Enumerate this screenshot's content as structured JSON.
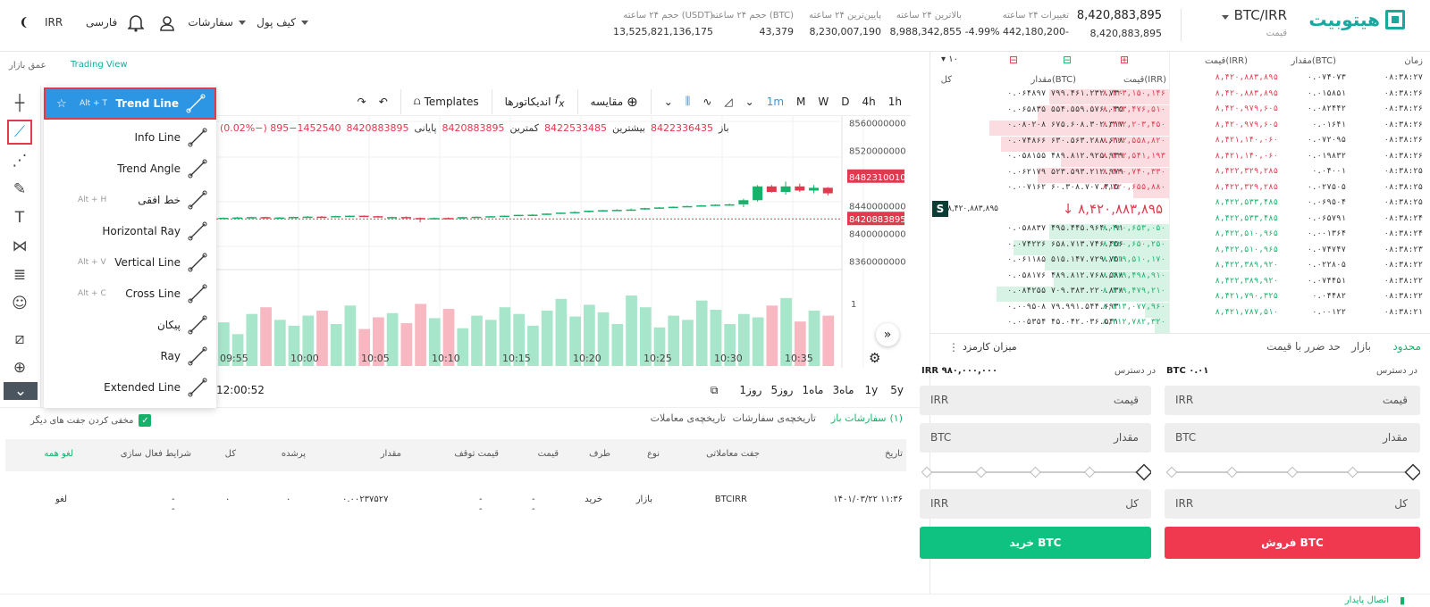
{
  "colors": {
    "accent": "#17b26a",
    "brand": "#18a8a0",
    "sell": "#e03a4e",
    "buy": "#0fc282",
    "highlight": "#2d96e4"
  },
  "header": {
    "logo": "هیتوبیت",
    "pair": "BTC/IRR",
    "pair_sub": "قیمت",
    "price_main": "8,420,883,895",
    "price_sub": "8,420,883,895",
    "stats": [
      {
        "label": "تغییرات ۲۴ ساعته",
        "value": "-4.99%  442,180,200-"
      },
      {
        "label": "بالاترین ۲۴ ساعته",
        "value": "8,988,342,855"
      },
      {
        "label": "پایین‌ترین ۲۴ ساعته",
        "value": "8,230,007,190"
      },
      {
        "label": "حجم ۲۴ ساعته (BTC)",
        "value": "43,379"
      },
      {
        "label": "حجم ۲۴ ساعته (USDT)",
        "value": "13,525,821,136,175"
      }
    ],
    "nav": {
      "wallet": "کیف پول",
      "orders": "سفارشات",
      "language": "فارسی",
      "currency": "IRR"
    }
  },
  "chart_tabs": {
    "trading_view": "Trading View",
    "depth": "عمق بازار"
  },
  "left_tools": [
    "crosshair-icon",
    "trend-line-icon",
    "fib-icon",
    "brush-icon",
    "text-icon",
    "pattern-icon",
    "prediction-icon",
    "emoji-icon",
    "ruler-icon",
    "zoom-in-icon",
    "collapse-icon"
  ],
  "draw_menu": [
    {
      "label": "Trend Line",
      "shortcut": "Alt + T",
      "icon": "trend-line-icon"
    },
    {
      "label": "Info Line",
      "shortcut": "",
      "icon": "info-line-icon"
    },
    {
      "label": "Trend Angle",
      "shortcut": "",
      "icon": "trend-angle-icon"
    },
    {
      "label": "خط افقی",
      "shortcut": "Alt + H",
      "icon": "horizontal-line-icon"
    },
    {
      "label": "Horizontal Ray",
      "shortcut": "",
      "icon": "horizontal-ray-icon"
    },
    {
      "label": "Vertical Line",
      "shortcut": "Alt + V",
      "icon": "vertical-line-icon"
    },
    {
      "label": "Cross Line",
      "shortcut": "Alt + C",
      "icon": "cross-line-icon"
    },
    {
      "label": "پیکان",
      "shortcut": "",
      "icon": "arrow-icon"
    },
    {
      "label": "Ray",
      "shortcut": "",
      "icon": "ray-icon"
    },
    {
      "label": "Extended Line",
      "shortcut": "",
      "icon": "extended-line-icon"
    }
  ],
  "chart_toolbar": {
    "intervals": [
      "1h",
      "4h",
      "D",
      "W",
      "M",
      "1m"
    ],
    "compare": "مقایسه",
    "indicators": "اندیکاتورها",
    "templates": "Templates"
  },
  "ohlc": {
    "open_label": "باز",
    "open": "8422336435",
    "high_label": "بیشترین",
    "high": "8422533485",
    "low_label": "کمترین",
    "low": "8420883895",
    "close_label": "پایانی",
    "close": "8420883895",
    "change": "895−1452540 (−0.02%)"
  },
  "price_axis": [
    "8560000000",
    "8520000000",
    "8482310010",
    "8440000000",
    "8420883895",
    "8400000000",
    "8360000000"
  ],
  "volume_axis": "1",
  "time_axis": [
    "09:55",
    "10:00",
    "10:05",
    "10:10",
    "10:15",
    "10:20",
    "10:25",
    "10:30",
    "10:35"
  ],
  "timeframe": {
    "ranges": [
      "5y",
      "1y",
      "3ماه",
      "1ماه",
      "5روز",
      "1روز"
    ],
    "clock": "12:00:52"
  },
  "chart_data": {
    "type": "candlestick",
    "candles": [
      [
        8422,
        8423,
        8421,
        8422.5
      ],
      [
        8422.5,
        8424,
        8422,
        8423
      ],
      [
        8423,
        8424,
        8422.5,
        8423.5
      ],
      [
        8423.5,
        8424,
        8422,
        8422.2
      ],
      [
        8422.2,
        8423.5,
        8421.5,
        8423
      ],
      [
        8423,
        8424,
        8422.5,
        8423.8
      ],
      [
        8423.8,
        8425,
        8423,
        8424.2
      ],
      [
        8424.2,
        8425,
        8423.5,
        8424
      ],
      [
        8424,
        8425.5,
        8423.5,
        8425
      ],
      [
        8425,
        8426,
        8424.5,
        8425.5
      ],
      [
        8425.5,
        8426,
        8424.5,
        8424.8
      ],
      [
        8424.8,
        8425.5,
        8423,
        8423.4
      ],
      [
        8423.4,
        8424,
        8422.5,
        8423.6
      ],
      [
        8423.6,
        8424.5,
        8422,
        8422.2
      ],
      [
        8422.2,
        8423,
        8416,
        8421
      ],
      [
        8421,
        8423,
        8420,
        8422.2
      ],
      [
        8422.2,
        8423,
        8421.5,
        8421.5
      ],
      [
        8421.5,
        8424,
        8421,
        8423.5
      ],
      [
        8423.5,
        8424.5,
        8423,
        8424
      ],
      [
        8424,
        8425,
        8423.5,
        8424.8
      ],
      [
        8424.8,
        8426,
        8424,
        8425.5
      ],
      [
        8425.5,
        8427,
        8425,
        8426.8
      ],
      [
        8426.8,
        8428,
        8426,
        8427
      ],
      [
        8427,
        8429,
        8426.5,
        8428.6
      ],
      [
        8428.6,
        8430,
        8428,
        8430
      ],
      [
        8430,
        8432,
        8429,
        8430.8
      ],
      [
        8430.8,
        8433,
        8430,
        8432.8
      ],
      [
        8432.8,
        8434,
        8432,
        8433.5
      ],
      [
        8433.5,
        8435,
        8433,
        8434
      ],
      [
        8434,
        8436,
        8433.5,
        8434.5
      ],
      [
        8434.5,
        8437,
        8434,
        8436.5
      ],
      [
        8436.5,
        8438,
        8436,
        8437.5
      ],
      [
        8437.5,
        8439,
        8437,
        8438.5
      ],
      [
        8438.5,
        8440,
        8438,
        8439.5
      ],
      [
        8439.5,
        8441,
        8439,
        8440.5
      ],
      [
        8440.5,
        8442,
        8440,
        8441.5
      ],
      [
        8441.5,
        8443,
        8441,
        8442
      ],
      [
        8442,
        8450,
        8438,
        8448
      ],
      [
        8448,
        8470,
        8446,
        8468
      ],
      [
        8468,
        8470,
        8459,
        8460
      ],
      [
        8460,
        8475,
        8456,
        8468
      ],
      [
        8468,
        8472,
        8460,
        8462
      ],
      [
        8462,
        8470,
        8458,
        8466
      ],
      [
        8466,
        8467,
        8455,
        8458
      ]
    ],
    "volumes": [
      0.52,
      0.38,
      0.62,
      0.7,
      0.55,
      0.48,
      0.6,
      0.66,
      0.5,
      0.72,
      0.44,
      0.58,
      0.63,
      0.51,
      0.74,
      0.57,
      0.68,
      0.45,
      0.6,
      0.55,
      0.7,
      0.62,
      0.48,
      0.66,
      0.8,
      0.59,
      0.73,
      0.64,
      0.5,
      0.84,
      0.7,
      0.46,
      0.6,
      0.55,
      0.78,
      0.67,
      0.5,
      0.62,
      0.58,
      0.72,
      0.81,
      0.53,
      0.66,
      0.6
    ],
    "ylim": [
      8350,
      8570
    ]
  },
  "order_tabs": {
    "open": "سفارشات باز",
    "open_count": "(۱)",
    "history": "تاریخچه‌ی سفارشات",
    "trades": "تاریخچه‌ی معاملات",
    "hide_others": "مخفی کردن جفت های دیگر"
  },
  "orders_table": {
    "headers": [
      "تاریخ",
      "جفت معاملاتی",
      "نوع",
      "طرف",
      "قیمت",
      "قیمت توقف",
      "مقدار",
      "پرشده",
      "کل",
      "شرایط فعال سازی",
      "لغو همه"
    ],
    "row": [
      "۱۴۰۱/۰۳/۲۲ ۱۱:۳۶",
      "BTCIRR",
      "بازار",
      "خرید",
      "--",
      "--",
      "۰.۰۰۲۳۷۵۲۷",
      "۰",
      "۰",
      "--",
      "لغو"
    ]
  },
  "orderbook": {
    "headers_left": [
      "زمان",
      "مقدار(BTC)",
      "قیمت(IRR)"
    ],
    "headers_right": [
      "کل",
      "مقدار(BTC)",
      "قیمت(IRR)"
    ],
    "depth_select": "۱۰",
    "trades": [
      [
        "۰۸:۳۸:۲۷",
        "۰.۰۷۴۰۷۳",
        "۸,۴۲۰,۸۸۳,۸۹۵",
        "sell"
      ],
      [
        "۰۸:۳۸:۲۶",
        "۰.۰۱۵۸۵۱",
        "۸,۴۲۰,۸۸۳,۸۹۵",
        "sell"
      ],
      [
        "۰۸:۳۸:۲۶",
        "۰.۰۸۲۴۴۲",
        "۸,۴۲۰,۹۷۹,۶۰۵",
        "sell"
      ],
      [
        "۰۸:۳۸:۲۶",
        "۰.۰۱۶۴۱",
        "۸,۴۲۰,۹۷۹,۶۰۵",
        "sell"
      ],
      [
        "۰۸:۳۸:۲۶",
        "۰.۰۷۲۰۹۵",
        "۸,۴۲۱,۱۴۰,۰۶۰",
        "sell"
      ],
      [
        "۰۸:۳۸:۲۶",
        "۰.۰۱۹۸۳۲",
        "۸,۴۲۱,۱۴۰,۰۶۰",
        "sell"
      ],
      [
        "۰۸:۳۸:۲۵",
        "۰.۰۴۰۰۱",
        "۸,۴۲۲,۳۲۹,۲۸۵",
        "sell"
      ],
      [
        "۰۸:۳۸:۲۵",
        "۰.۰۲۷۵۰۵",
        "۸,۴۲۲,۳۲۹,۲۸۵",
        "sell"
      ],
      [
        "۰۸:۳۸:۲۵",
        "۰.۰۶۹۵۰۴",
        "۸,۴۲۲,۵۳۳,۴۸۵",
        "green"
      ],
      [
        "۰۸:۳۸:۲۴",
        "۰.۰۶۵۷۹۱",
        "۸,۴۲۲,۵۳۳,۴۸۵",
        "green"
      ],
      [
        "۰۸:۳۸:۲۴",
        "۰.۰۰۱۳۶۴",
        "۸,۴۲۲,۵۱۰,۹۶۵",
        "green"
      ],
      [
        "۰۸:۳۸:۲۳",
        "۰.۰۷۴۷۴۷",
        "۸,۴۲۲,۵۱۰,۹۶۵",
        "green"
      ],
      [
        "۰۸:۳۸:۲۲",
        "۰.۰۲۲۸۰۵",
        "۸,۴۲۲,۳۸۹,۹۲۰",
        "green"
      ],
      [
        "۰۸:۳۸:۲۲",
        "۰.۰۷۴۴۵۱",
        "۸,۴۲۲,۳۸۹,۹۲۰",
        "green"
      ],
      [
        "۰۸:۳۸:۲۲",
        "۰.۰۴۴۸۲",
        "۸,۴۲۱,۷۹۰,۳۲۵",
        "green"
      ],
      [
        "۰۸:۳۸:۲۱",
        "۰.۰۰۱۲۲",
        "۸,۴۲۱,۷۸۷,۵۱۰",
        "green"
      ]
    ],
    "asks": [
      [
        "۰.۰۶۴۸۹۷ ۷۹۹.۴۶۱.۲۳۲.۷۳۰",
        "۸,۴۲۳,۱۵۰,۱۴۶",
        0.5
      ],
      [
        "۰.۰۶۵۸۳۵ ۵۵۴.۵۵۹.۵۷۶.۰۳۵",
        "۸,۴۲۳,۴۷۶,۵۱۰",
        0.55
      ],
      [
        "۰.۰۸۰۲۰۸ ۶۷۵.۶۰۸.۳۰۲.۳۱۷",
        "۸,۴۲۲,۲۰۳,۴۵۰",
        0.75
      ],
      [
        "۰.۰۷۴۸۶۶ ۶۳۰.۵۶۳.۲۸۸.۶۱۸",
        "۸,۴۲۲,۵۵۸,۸۲۰",
        0.7
      ],
      [
        "۰.۰۵۸۱۵۵ ۴۸۹.۸۱۲.۹۲۵.۹۳۹",
        "۸,۴۲۲,۵۴۱,۱۹۳",
        0.45
      ],
      [
        "۰.۰۶۲۱۷۹ ۵۲۳.۵۹۳.۲۱۲.۹۷۹",
        "۸,۴۲۰,۷۴۰,۳۳۰",
        0.55
      ],
      [
        "۰.۰۰۷۱۶۲ ۶۰.۳۰۸.۷۰۷.۴۱۵",
        "۸,۴۲۰,۶۵۵,۸۸۰",
        0.15
      ]
    ],
    "mid": {
      "price": "۸,۴۲۰,۸۸۳,۸۹۵",
      "small": "۸,۴۲۰,۸۸۳,۸۹۵",
      "badge": "S"
    },
    "bids": [
      [
        "۰.۰۵۸۸۳۷ ۴۹۵.۴۴۵.۹۶۴.۰۹۱",
        "۸,۴۲۰,۶۵۳,۰۵۰",
        0.5
      ],
      [
        "۰.۰۷۴۲۲۶ ۶۵۸.۷۱۳.۷۴۶.۴۵۶",
        "۸,۴۲۰,۶۵۰,۲۵۰",
        0.65
      ],
      [
        "۰.۰۶۱۱۸۵ ۵۱۵.۱۴۷.۷۲۹.۷۵۱",
        "۸,۴۱۹,۵۱۰,۱۷۰",
        0.52
      ],
      [
        "۰.۰۵۸۱۷۶ ۴۸۹.۸۱۲.۷۶۸.۵۸۸",
        "۸,۴۱۹,۴۹۸,۹۱۰",
        0.48
      ],
      [
        "۰.۰۸۴۲۵۵ ۷۰۹.۳۸۳.۲۲۰.۸۳۸",
        "۸,۴۱۹,۴۷۹,۲۱۰",
        0.72
      ],
      [
        "۰.۰۰۹۵۰۸ ۷۹.۹۹۱.۵۴۴.۶۹۳",
        "۸,۴۱۳,۰۷۷,۹۶۰",
        0.1
      ],
      [
        "۰.۰۰۵۳۵۴ ۴۵.۰۴۲.۰۳۶.۵۴۱",
        "۸,۴۱۲,۷۸۲,۳۲۰",
        0.06
      ]
    ]
  },
  "trade": {
    "tabs": {
      "limit": "محدود",
      "market": "بازار",
      "stop": "حد ضرر با قیمت"
    },
    "fee": "میزان کارمزد",
    "available_label": "در دسترس",
    "btc_available": "BTC ۰.۰۱",
    "irr_available": "IRR ۹۸۰,۰۰۰,۰۰۰",
    "price": "قیمت",
    "amount": "مقدار",
    "total": "کل",
    "irr": "IRR",
    "btc": "BTC",
    "sell_btn": "فروش BTC",
    "buy_btn": "خرید BTC"
  },
  "footer": {
    "status": "اتصال پایدار"
  }
}
